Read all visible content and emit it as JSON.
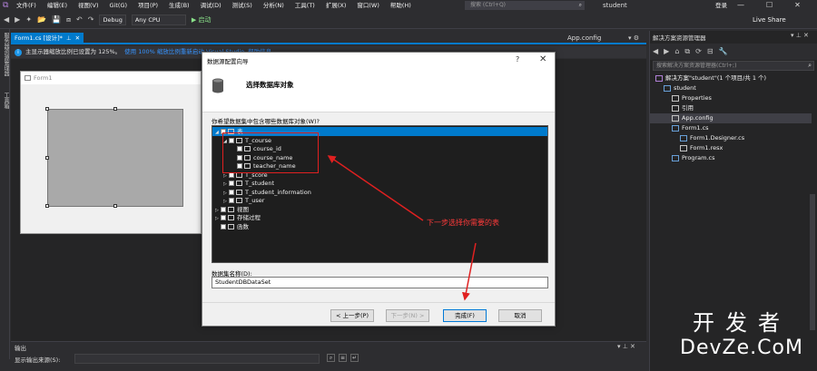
{
  "menubar": {
    "items": [
      "文件(F)",
      "编辑(E)",
      "视图(V)",
      "Git(G)",
      "项目(P)",
      "生成(B)",
      "调试(D)",
      "测试(S)",
      "分析(N)",
      "工具(T)",
      "扩展(X)",
      "窗口(W)",
      "帮助(H)"
    ],
    "search_placeholder": "搜索 (Ctrl+Q)",
    "solution_name": "student",
    "login": "登录"
  },
  "toolbar": {
    "config": "Debug",
    "platform": "Any CPU",
    "start_label": "▶ 启动",
    "live_share": "Live Share"
  },
  "left_strip": {
    "server_explorer": "服务器资源管理器",
    "toolbox": "工具箱"
  },
  "doc_tabs": {
    "active": "Form1.cs [设计]*",
    "right": "App.config"
  },
  "infobar": {
    "message": "主显示器缩放比例已设置为 125%。",
    "link1": "使用 100% 缩放比例重新启动 Visual Studio",
    "link2": "帮助信息"
  },
  "designer": {
    "form_title": "Form1"
  },
  "output": {
    "title": "输出",
    "source_label": "显示输出来源(S):"
  },
  "solution_explorer": {
    "title": "解决方案资源管理器",
    "search_placeholder": "搜索解决方案资源管理器(Ctrl+;)",
    "nodes": [
      {
        "label": "解决方案\"student\"(1 个项目/共 1 个)",
        "level": 0,
        "icon": "solution-icon"
      },
      {
        "label": "student",
        "level": 1,
        "icon": "csharp-project-icon"
      },
      {
        "label": "Properties",
        "level": 2,
        "icon": "wrench-icon"
      },
      {
        "label": "引用",
        "level": 2,
        "icon": "references-icon"
      },
      {
        "label": "App.config",
        "level": 2,
        "icon": "config-icon",
        "selected": true
      },
      {
        "label": "Form1.cs",
        "level": 2,
        "icon": "form-icon"
      },
      {
        "label": "Form1.Designer.cs",
        "level": 3,
        "icon": "csharp-file-icon"
      },
      {
        "label": "Form1.resx",
        "level": 3,
        "icon": "resx-icon"
      },
      {
        "label": "Program.cs",
        "level": 2,
        "icon": "csharp-file-icon"
      }
    ]
  },
  "dialog": {
    "title": "数据源配置向导",
    "help": "?",
    "close": "✕",
    "heading": "选择数据库对象",
    "question": "你希望数据集中包含哪些数据库对象(W)?",
    "tree": [
      {
        "label": "表",
        "level": 0,
        "arrow": "◢",
        "selected": true
      },
      {
        "label": "T_course",
        "level": 1,
        "arrow": "◢"
      },
      {
        "label": "course_id",
        "level": 2,
        "arrow": ""
      },
      {
        "label": "course_name",
        "level": 2,
        "arrow": ""
      },
      {
        "label": "teacher_name",
        "level": 2,
        "arrow": ""
      },
      {
        "label": "T_score",
        "level": 1,
        "arrow": "▷"
      },
      {
        "label": "T_student",
        "level": 1,
        "arrow": "▷"
      },
      {
        "label": "T_student_information",
        "level": 1,
        "arrow": "▷"
      },
      {
        "label": "T_user",
        "level": 1,
        "arrow": "▷"
      },
      {
        "label": "视图",
        "level": 0,
        "arrow": "▷"
      },
      {
        "label": "存储过程",
        "level": 0,
        "arrow": "▷"
      },
      {
        "label": "函数",
        "level": 0,
        "arrow": ""
      }
    ],
    "dataset_label": "数据集名称(D):",
    "dataset_value": "StudentDBDataSet",
    "buttons": {
      "prev": "< 上一步(P)",
      "next": "下一步(N) >",
      "finish": "完成(F)",
      "cancel": "取消"
    }
  },
  "annotation": {
    "text": "下一步选择你需要的表",
    "color": "#e02020"
  },
  "watermark": {
    "line1": "开发者",
    "line2": "DevZe.CoM"
  },
  "colors": {
    "accent": "#007acc",
    "bg": "#2d2d30",
    "annotation": "#e02020"
  }
}
